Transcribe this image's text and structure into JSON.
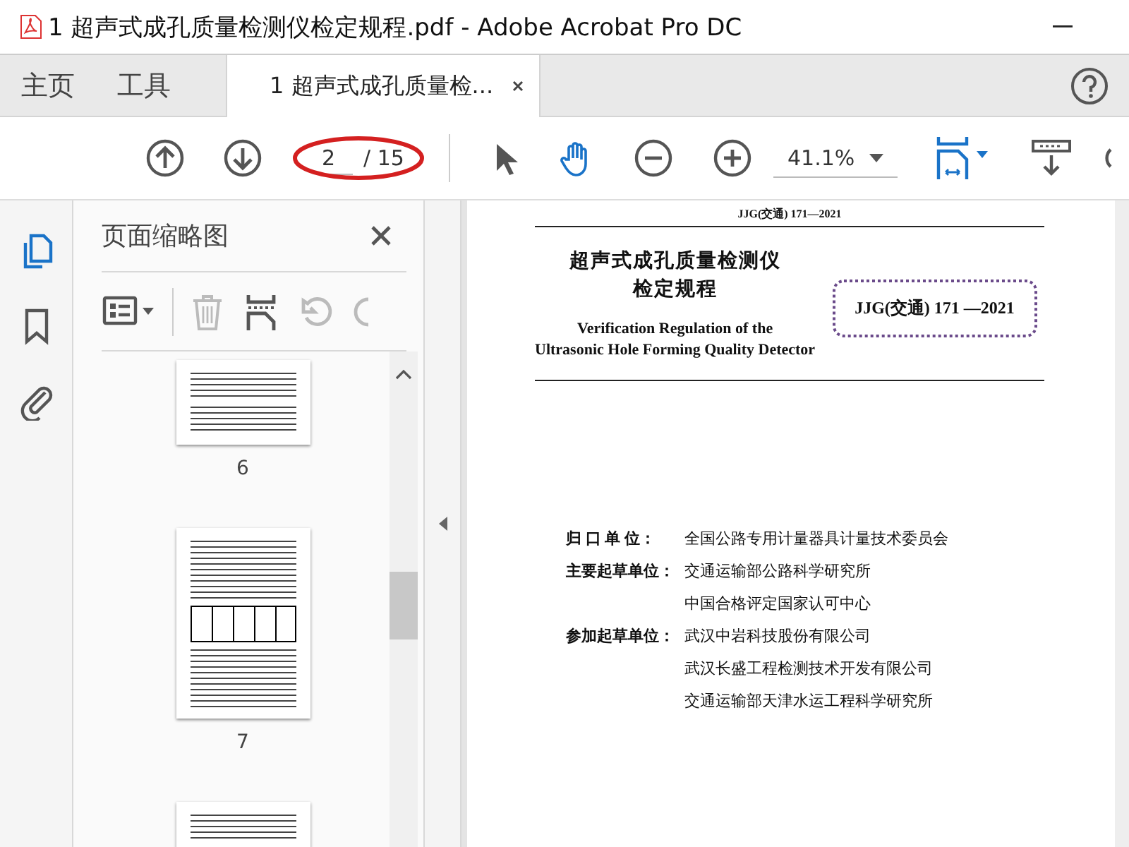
{
  "window": {
    "title": "1 超声式成孔质量检测仪检定规程.pdf - Adobe Acrobat Pro DC"
  },
  "nav_tabs": [
    {
      "label": "主页",
      "selected": false
    },
    {
      "label": "工具",
      "selected": false
    },
    {
      "label": "1 超声式成孔质量检...",
      "selected": true
    }
  ],
  "toolbar": {
    "page_current": "2",
    "page_total": "/ 15",
    "zoom": "41.1%"
  },
  "side_rail": [
    {
      "kind": "pages",
      "selected": true
    },
    {
      "kind": "bookmark",
      "selected": false
    },
    {
      "kind": "attachment",
      "selected": false
    }
  ],
  "thumbnails_panel": {
    "title": "页面缩略图",
    "tools": [
      {
        "kind": "options",
        "disabled": false
      },
      {
        "kind": "delete",
        "disabled": true
      },
      {
        "kind": "insert",
        "disabled": false
      },
      {
        "kind": "rotate-left",
        "disabled": true
      },
      {
        "kind": "rotate-right",
        "disabled": true
      }
    ],
    "pages": [
      {
        "kind": "top-cut",
        "label": "6"
      },
      {
        "kind": "full",
        "label": "7"
      },
      {
        "kind": "bottom-cut"
      }
    ]
  },
  "document": {
    "header": "JJG(交通) 171—2021",
    "title_lines": [
      "超声式成孔质量检测仪",
      "检定规程"
    ],
    "english_lines": [
      "Verification Regulation of the",
      "Ultrasonic Hole Forming Quality Detector"
    ],
    "code_box": "JJG(交通) 171 —2021",
    "organizations": [
      {
        "label": "归 口 单 位：",
        "names": [
          "全国公路专用计量器具计量技术委员会"
        ]
      },
      {
        "label": "主要起草单位：",
        "names": [
          "交通运输部公路科学研究所",
          "中国合格评定国家认可中心"
        ]
      },
      {
        "label": "参加起草单位：",
        "names": [
          "武汉中岩科技股份有限公司",
          "武汉长盛工程检测技术开发有限公司",
          "交通运输部天津水运工程科学研究所"
        ]
      }
    ]
  }
}
